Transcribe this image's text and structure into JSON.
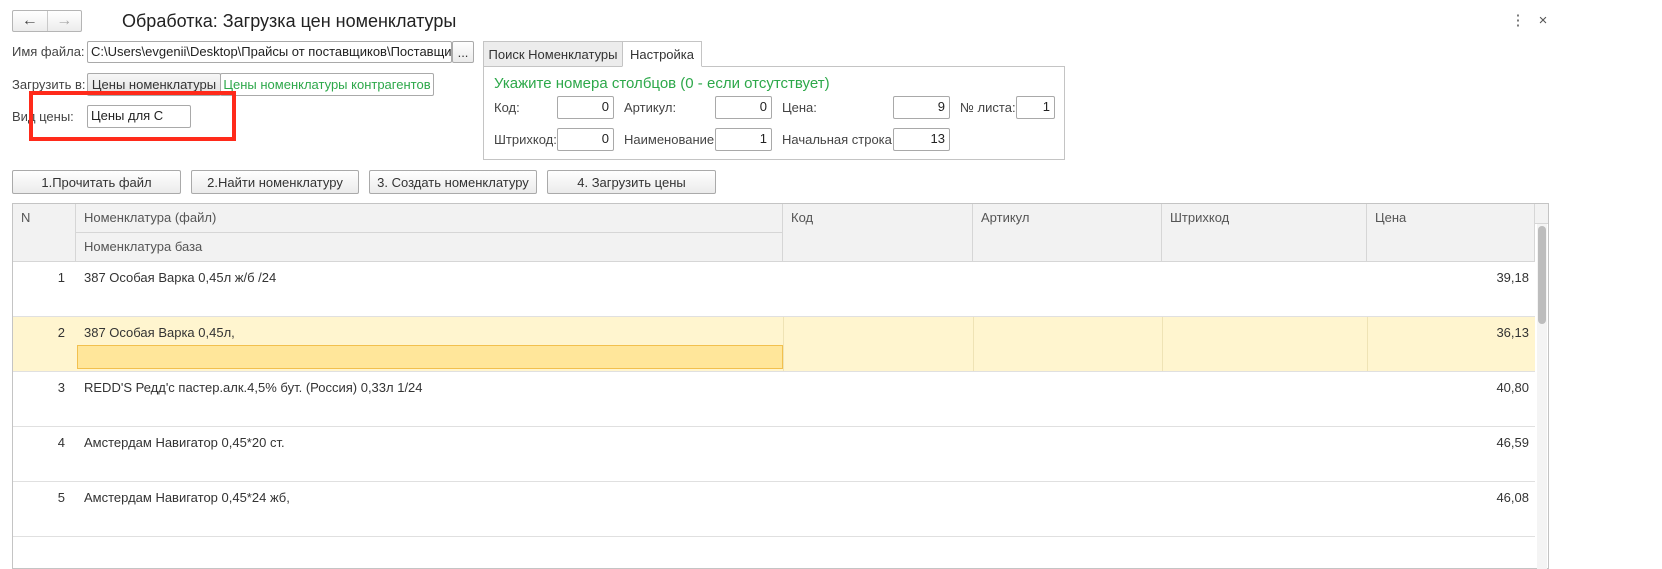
{
  "window": {
    "title": "Обработка: Загрузка цен номенклатуры",
    "back_icon": "←",
    "forward_icon": "→",
    "more_icon": "⋮",
    "close_icon": "×"
  },
  "file": {
    "label": "Имя файла:",
    "value": "C:\\Users\\evgenii\\Desktop\\Прайсы от поставщиков\\Поставщики\\",
    "browse_label": "..."
  },
  "load_to": {
    "label": "Загрузить в:",
    "options": [
      "Цены номенклатуры",
      "Цены номенклатуры контрагентов"
    ]
  },
  "price_type": {
    "label": "Вид цены:",
    "value": "Цены для С"
  },
  "tabs": [
    "Поиск Номенклатуры",
    "Настройка"
  ],
  "settings": {
    "heading": "Укажите номера столбцов (0 - если отсутствует)",
    "fields": [
      {
        "label": "Код:",
        "value": "0"
      },
      {
        "label": "Артикул:",
        "value": "0"
      },
      {
        "label": "Цена:",
        "value": "9"
      },
      {
        "label": "№ листа:",
        "value": "1"
      },
      {
        "label": "Штрихкод:",
        "value": "0"
      },
      {
        "label": "Наименование:",
        "value": "1"
      },
      {
        "label": "Начальная строка:",
        "value": "13"
      }
    ]
  },
  "actions": [
    "1.Прочитать файл",
    "2.Найти номенклатуру",
    "3. Создать номенклатуру",
    "4. Загрузить цены"
  ],
  "table": {
    "columns": {
      "n": "N",
      "nom_file": "Номенклатура (файл)",
      "nom_base": "Номенклатура база",
      "code": "Код",
      "article": "Артикул",
      "barcode": "Штрихкод",
      "price": "Цена"
    },
    "rows": [
      {
        "n": "1",
        "name": "387 Особая Варка 0,45л ж/б /24",
        "price": "39,18"
      },
      {
        "n": "2",
        "name": "387 Особая Варка 0,45л,",
        "price": "36,13"
      },
      {
        "n": "3",
        "name": "REDD'S Редд'с пастер.алк.4,5% бут. (Россия) 0,33л 1/24",
        "price": "40,80"
      },
      {
        "n": "4",
        "name": "Амстердам Навигатор 0,45*20 ст.",
        "price": "46,59"
      },
      {
        "n": "5",
        "name": "Амстердам Навигатор 0,45*24 жб,",
        "price": "46,08"
      }
    ]
  }
}
